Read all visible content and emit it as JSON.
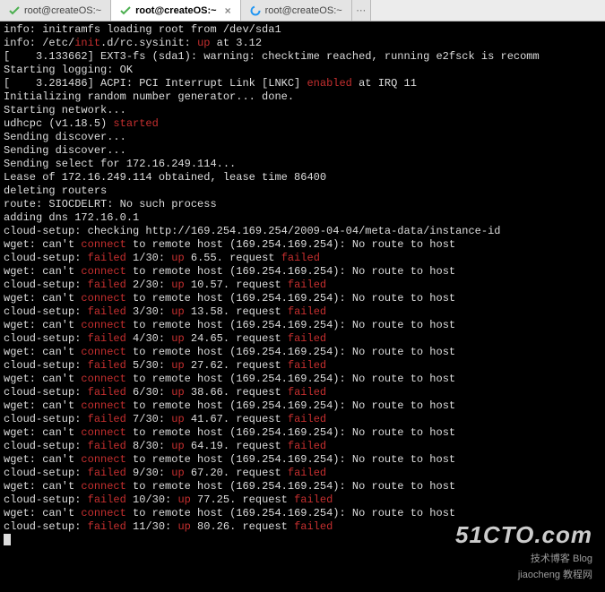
{
  "tabs": [
    {
      "label": "root@createOS:~",
      "icon": "check"
    },
    {
      "label": "root@createOS:~",
      "icon": "check",
      "active": true
    },
    {
      "label": "root@createOS:~",
      "icon": "spinner"
    }
  ],
  "colors": {
    "red": "#c62f2f",
    "fg": "#dddddd",
    "bg": "#000000"
  },
  "term_lines": [
    [
      [
        "w",
        "info: initramfs loading root from /dev/sda1"
      ]
    ],
    [
      [
        "w",
        "info: /etc/"
      ],
      [
        "r",
        "init"
      ],
      [
        "w",
        ".d/rc.sysinit: "
      ],
      [
        "r",
        "up"
      ],
      [
        "w",
        " at 3.12"
      ]
    ],
    [
      [
        "w",
        "[    3.133662] EXT3-fs (sda1): warning: checktime reached, running e2fsck is recomm"
      ]
    ],
    [
      [
        "w",
        "Starting logging: OK"
      ]
    ],
    [
      [
        "w",
        "[    3.281486] ACPI: PCI Interrupt Link [LNKC] "
      ],
      [
        "r",
        "enabled"
      ],
      [
        "w",
        " at IRQ 11"
      ]
    ],
    [
      [
        "w",
        "Initializing random number generator... done."
      ]
    ],
    [
      [
        "w",
        "Starting network..."
      ]
    ],
    [
      [
        "w",
        "udhcpc (v1.18.5) "
      ],
      [
        "r",
        "started"
      ]
    ],
    [
      [
        "w",
        "Sending discover..."
      ]
    ],
    [
      [
        "w",
        "Sending discover..."
      ]
    ],
    [
      [
        "w",
        "Sending select for 172.16.249.114..."
      ]
    ],
    [
      [
        "w",
        "Lease of 172.16.249.114 obtained, lease time 86400"
      ]
    ],
    [
      [
        "w",
        "deleting routers"
      ]
    ],
    [
      [
        "w",
        "route: SIOCDELRT: No such process"
      ]
    ],
    [
      [
        "w",
        "adding dns 172.16.0.1"
      ]
    ],
    [
      [
        "w",
        "cloud-setup: checking http://169.254.169.254/2009-04-04/meta-data/instance-id"
      ]
    ],
    [
      [
        "w",
        "wget: can't "
      ],
      [
        "r",
        "connect"
      ],
      [
        "w",
        " to remote host (169.254.169.254): No route to host"
      ]
    ],
    [
      [
        "w",
        "cloud-setup: "
      ],
      [
        "r",
        "failed"
      ],
      [
        "w",
        " 1/30: "
      ],
      [
        "r",
        "up"
      ],
      [
        "w",
        " 6.55. request "
      ],
      [
        "r",
        "failed"
      ]
    ],
    [
      [
        "w",
        "wget: can't "
      ],
      [
        "r",
        "connect"
      ],
      [
        "w",
        " to remote host (169.254.169.254): No route to host"
      ]
    ],
    [
      [
        "w",
        "cloud-setup: "
      ],
      [
        "r",
        "failed"
      ],
      [
        "w",
        " 2/30: "
      ],
      [
        "r",
        "up"
      ],
      [
        "w",
        " 10.57. request "
      ],
      [
        "r",
        "failed"
      ]
    ],
    [
      [
        "w",
        "wget: can't "
      ],
      [
        "r",
        "connect"
      ],
      [
        "w",
        " to remote host (169.254.169.254): No route to host"
      ]
    ],
    [
      [
        "w",
        "cloud-setup: "
      ],
      [
        "r",
        "failed"
      ],
      [
        "w",
        " 3/30: "
      ],
      [
        "r",
        "up"
      ],
      [
        "w",
        " 13.58. request "
      ],
      [
        "r",
        "failed"
      ]
    ],
    [
      [
        "w",
        "wget: can't "
      ],
      [
        "r",
        "connect"
      ],
      [
        "w",
        " to remote host (169.254.169.254): No route to host"
      ]
    ],
    [
      [
        "w",
        "cloud-setup: "
      ],
      [
        "r",
        "failed"
      ],
      [
        "w",
        " 4/30: "
      ],
      [
        "r",
        "up"
      ],
      [
        "w",
        " 24.65. request "
      ],
      [
        "r",
        "failed"
      ]
    ],
    [
      [
        "w",
        "wget: can't "
      ],
      [
        "r",
        "connect"
      ],
      [
        "w",
        " to remote host (169.254.169.254): No route to host"
      ]
    ],
    [
      [
        "w",
        "cloud-setup: "
      ],
      [
        "r",
        "failed"
      ],
      [
        "w",
        " 5/30: "
      ],
      [
        "r",
        "up"
      ],
      [
        "w",
        " 27.62. request "
      ],
      [
        "r",
        "failed"
      ]
    ],
    [
      [
        "w",
        "wget: can't "
      ],
      [
        "r",
        "connect"
      ],
      [
        "w",
        " to remote host (169.254.169.254): No route to host"
      ]
    ],
    [
      [
        "w",
        "cloud-setup: "
      ],
      [
        "r",
        "failed"
      ],
      [
        "w",
        " 6/30: "
      ],
      [
        "r",
        "up"
      ],
      [
        "w",
        " 38.66. request "
      ],
      [
        "r",
        "failed"
      ]
    ],
    [
      [
        "w",
        "wget: can't "
      ],
      [
        "r",
        "connect"
      ],
      [
        "w",
        " to remote host (169.254.169.254): No route to host"
      ]
    ],
    [
      [
        "w",
        "cloud-setup: "
      ],
      [
        "r",
        "failed"
      ],
      [
        "w",
        " 7/30: "
      ],
      [
        "r",
        "up"
      ],
      [
        "w",
        " 41.67. request "
      ],
      [
        "r",
        "failed"
      ]
    ],
    [
      [
        "w",
        "wget: can't "
      ],
      [
        "r",
        "connect"
      ],
      [
        "w",
        " to remote host (169.254.169.254): No route to host"
      ]
    ],
    [
      [
        "w",
        "cloud-setup: "
      ],
      [
        "r",
        "failed"
      ],
      [
        "w",
        " 8/30: "
      ],
      [
        "r",
        "up"
      ],
      [
        "w",
        " 64.19. request "
      ],
      [
        "r",
        "failed"
      ]
    ],
    [
      [
        "w",
        "wget: can't "
      ],
      [
        "r",
        "connect"
      ],
      [
        "w",
        " to remote host (169.254.169.254): No route to host"
      ]
    ],
    [
      [
        "w",
        "cloud-setup: "
      ],
      [
        "r",
        "failed"
      ],
      [
        "w",
        " 9/30: "
      ],
      [
        "r",
        "up"
      ],
      [
        "w",
        " 67.20. request "
      ],
      [
        "r",
        "failed"
      ]
    ],
    [
      [
        "w",
        "wget: can't "
      ],
      [
        "r",
        "connect"
      ],
      [
        "w",
        " to remote host (169.254.169.254): No route to host"
      ]
    ],
    [
      [
        "w",
        "cloud-setup: "
      ],
      [
        "r",
        "failed"
      ],
      [
        "w",
        " 10/30: "
      ],
      [
        "r",
        "up"
      ],
      [
        "w",
        " 77.25. request "
      ],
      [
        "r",
        "failed"
      ]
    ],
    [
      [
        "w",
        "wget: can't "
      ],
      [
        "r",
        "connect"
      ],
      [
        "w",
        " to remote host (169.254.169.254): No route to host"
      ]
    ],
    [
      [
        "w",
        "cloud-setup: "
      ],
      [
        "r",
        "failed"
      ],
      [
        "w",
        " 11/30: "
      ],
      [
        "r",
        "up"
      ],
      [
        "w",
        " 80.26. request "
      ],
      [
        "r",
        "failed"
      ]
    ]
  ],
  "watermark": {
    "big": "51CTO.com",
    "small1": "技术博客   Blog",
    "small2": "jiaocheng 教程网"
  }
}
